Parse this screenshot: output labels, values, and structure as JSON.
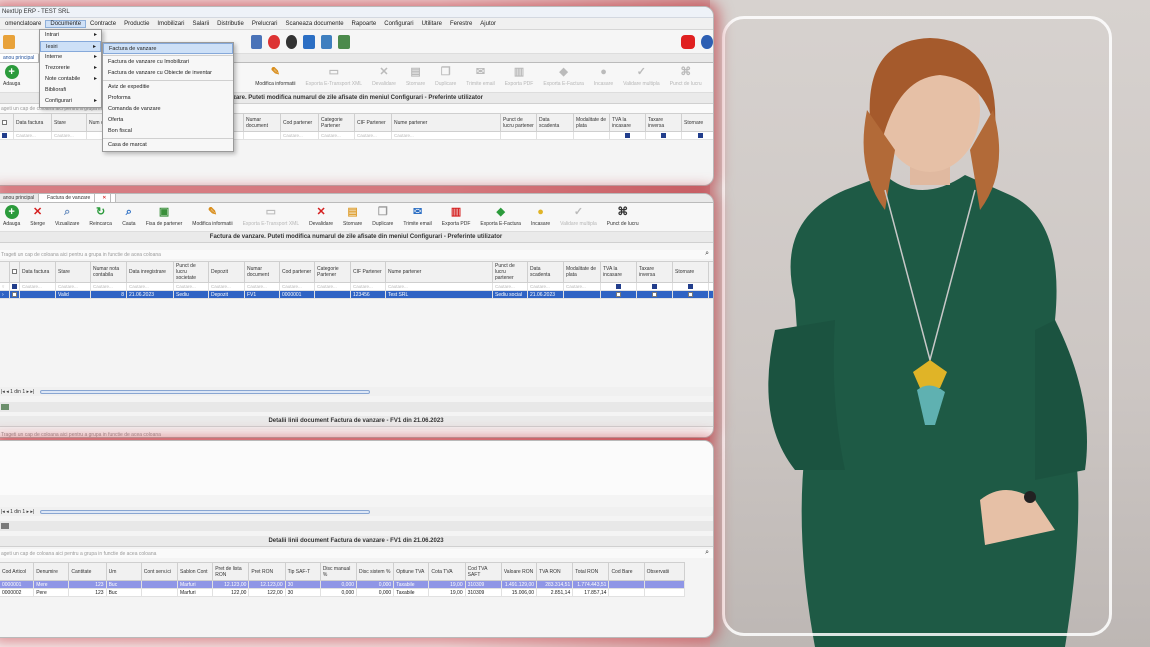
{
  "app": {
    "title": "NextUp ERP - TEST SRL",
    "menu": [
      "omenclatoare",
      "Documente",
      "Contracte",
      "Productie",
      "Imobilizari",
      "Salarii",
      "Distributie",
      "Prelucrari",
      "Scaneaza documente",
      "Rapoarte",
      "Configurari",
      "Utilitare",
      "Ferestre",
      "Ajutor"
    ]
  },
  "w1": {
    "tab": "anou principal",
    "add_label": "Adauga",
    "menu1": [
      "Intrari",
      "Iesiri",
      "Interne",
      "Trezorerie",
      "Note contabile",
      "Bibliorafi",
      "Configurari"
    ],
    "menu2": [
      "Factura de vanzare",
      "Factura de vanzare cu Imobilizari",
      "Factura de vanzare cu Obiecte de inventar",
      "Aviz de expeditie",
      "Proforma",
      "Comanda de vanzare",
      "Oferta",
      "Bon fiscal",
      "Casa de marcat"
    ],
    "ribbon": [
      "Modifica informatii",
      "Exporta E-Transport XML",
      "Devalidare",
      "Stornare",
      "Duplicare",
      "Trimite email",
      "Exporta PDF",
      "Exporta E-Factura",
      "Incasare",
      "Validare multipla",
      "Punct de lucru"
    ],
    "caption": "tura de vanzare. Puteti modifica numarul de zile afisate din meniul Configurari - Preferinte utilizator",
    "hint": "ageti un cap de coloana aici pentru a grupa in functie de acea coloana",
    "columns": [
      "Data factura",
      "Stare",
      "Num cont",
      "Numar document",
      "Cod partener",
      "Categorie Partener",
      "CIF Partener",
      "Nume partener",
      "Punct de lucru partener",
      "Data scadenta",
      "Modalitate de plata",
      "TVA la incasare",
      "Taxare inversa",
      "Stornare"
    ],
    "filter": "Cautare..."
  },
  "w2": {
    "tabs": [
      "anou principal",
      "Factura de vanzare"
    ],
    "ribbon": [
      "Adauga",
      "Sterge",
      "Vizualizare",
      "Reincarca",
      "Cauta",
      "Fisa de partener",
      "Modifica informatii",
      "Exporta E-Transport XML",
      "Devalidare",
      "Stornare",
      "Duplicare",
      "Trimite email",
      "Exporta PDF",
      "Exporta E-Factura",
      "Incasare",
      "Validare multipla",
      "Punct de lucru"
    ],
    "caption": "Factura de vanzare. Puteti modifica numarul de zile afisate din meniul Configurari - Preferinte utilizator",
    "hint": "Trageti un cap de coloana aici pentru a grupa in functie de acea coloana",
    "columns": [
      "Data factura",
      "Stare",
      "Numar nota contabila",
      "Data inregistrare",
      "Punct de lucru societate",
      "Depozit",
      "Numar document",
      "Cod partener",
      "Categorie Partener",
      "CIF Partener",
      "Nume partener",
      "Punct de lucru partener",
      "Data scadenta",
      "Modalitate de plata",
      "TVA la incasare",
      "Taxare inversa",
      "Stornare"
    ],
    "row": [
      "",
      "Valid",
      "8",
      "21.06.2023",
      "Sediu",
      "Depozit",
      "FV1",
      "0000001",
      "",
      "123456",
      "Test SRL",
      "Sediu social",
      "21.06.2023",
      "",
      "",
      "",
      ""
    ],
    "pager": "1 din 1",
    "detail_caption": "Detalii linii document Factura de vanzare - FV1 din 21.06.2023",
    "detail_hint": "Trageti un cap de coloana aici pentru a grupa in functie de acea coloana"
  },
  "w3": {
    "pager": "1 din 1",
    "caption": "Detalii linii document Factura de vanzare - FV1 din 21.06.2023",
    "hint": "ageti un cap de coloana aici pentru a grupa in functie de acea coloana",
    "columns": [
      "Cod Articol",
      "Denumire",
      "Cantitate",
      "Um",
      "Cont serv.ici",
      "Sablon Cont",
      "Pret de lista RON",
      "Pret RON",
      "Tip SAF-T",
      "Disc manual %",
      "Disc sistem %",
      "Optiune TVA",
      "Cota TVA",
      "Cod TVA SAFT",
      "Valoare RON",
      "TVA RON",
      "Total RON",
      "Cod Bare",
      "Observatii"
    ],
    "rows": [
      [
        "0000001",
        "Mere",
        "123",
        "Buc",
        "",
        "Marfuri",
        "12.123,00",
        "12.123,00",
        "30",
        "0,000",
        "0,000",
        "Taxabile",
        "19,00",
        "310309",
        "1.491.129,00",
        "283.314,51",
        "1.774.443,51",
        "",
        ""
      ],
      [
        "0000002",
        "Pere",
        "123",
        "Buc",
        "",
        "Marfuri",
        "122,00",
        "122,00",
        "30",
        "0,000",
        "0,000",
        "Taxabile",
        "19,00",
        "310309",
        "15.006,00",
        "2.851,14",
        "17.857,14",
        "",
        ""
      ]
    ]
  }
}
